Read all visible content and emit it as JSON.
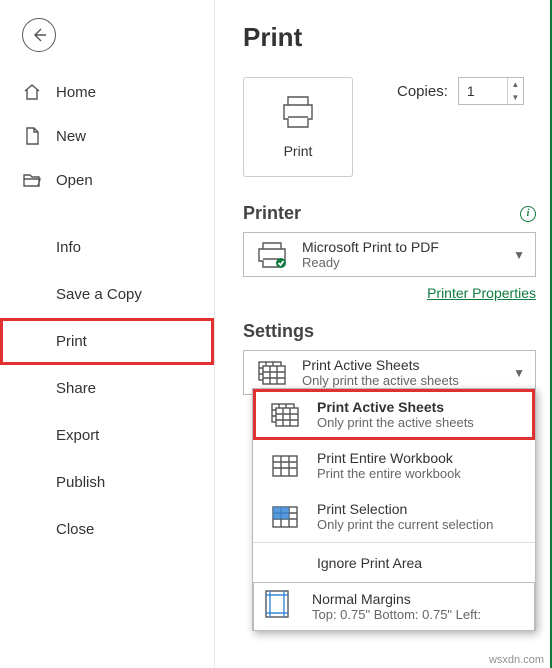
{
  "sidebar": {
    "home": "Home",
    "new": "New",
    "open": "Open",
    "info": "Info",
    "save_copy": "Save a Copy",
    "print": "Print",
    "share": "Share",
    "export": "Export",
    "publish": "Publish",
    "close": "Close"
  },
  "page": {
    "title": "Print",
    "print_button": "Print",
    "copies_label": "Copies:",
    "copies_value": "1"
  },
  "printer": {
    "section": "Printer",
    "name": "Microsoft Print to PDF",
    "status": "Ready",
    "properties_link": "Printer Properties"
  },
  "settings": {
    "section": "Settings",
    "selected_title": "Print Active Sheets",
    "selected_sub": "Only print the active sheets",
    "options": [
      {
        "title": "Print Active Sheets",
        "sub": "Only print the active sheets"
      },
      {
        "title": "Print Entire Workbook",
        "sub": "Print the entire workbook"
      },
      {
        "title": "Print Selection",
        "sub": "Only print the current selection"
      }
    ],
    "ignore": "Ignore Print Area",
    "margins_title": "Normal Margins",
    "margins_sub": "Top: 0.75\" Bottom: 0.75\" Left:"
  },
  "watermark": "wsxdn.com"
}
